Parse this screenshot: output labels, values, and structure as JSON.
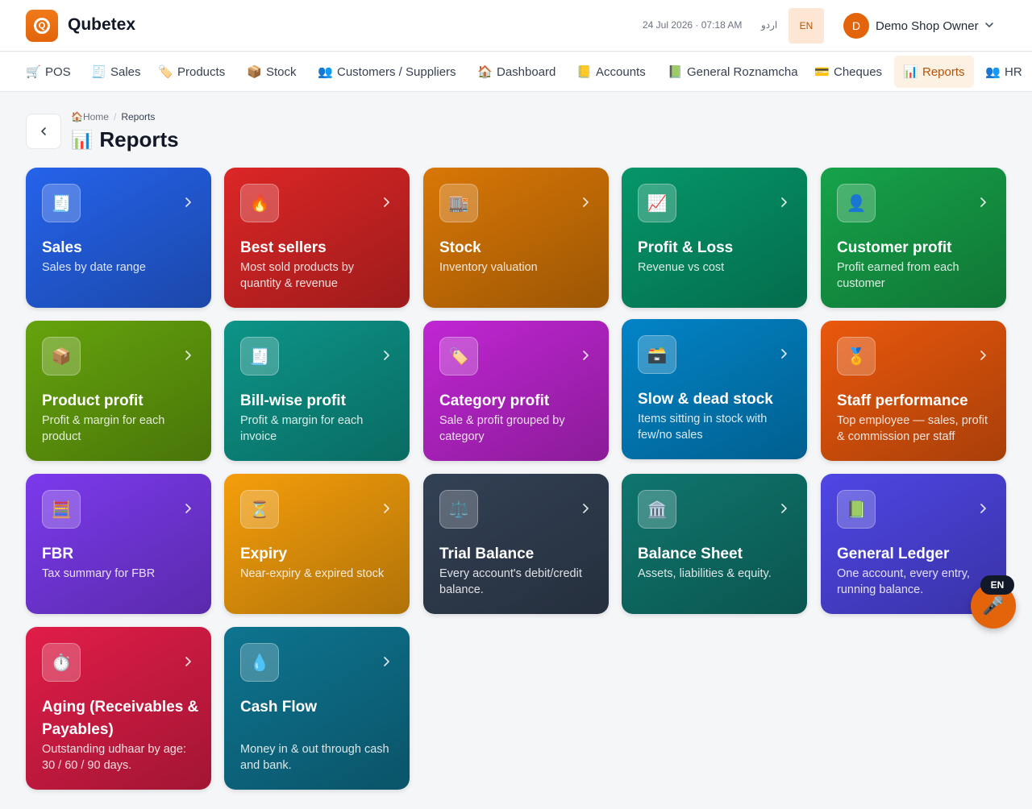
{
  "header": {
    "brand": "Qubetex",
    "logo_letter": "Q",
    "datetime": "24 Jul 2026 · 07:18 AM",
    "urdu_label": "اردو",
    "lang": "EN",
    "user_initial": "D",
    "user_name": "Demo Shop Owner"
  },
  "nav": [
    {
      "icon": "🛒",
      "label": "POS"
    },
    {
      "icon": "🧾",
      "label": "Sales"
    },
    {
      "icon": "🏷️",
      "label": "Products"
    },
    {
      "icon": "📦",
      "label": "Stock"
    },
    {
      "icon": "👥",
      "label": "Customers / Suppliers"
    },
    {
      "icon": "🏠",
      "label": "Dashboard"
    },
    {
      "icon": "📒",
      "label": "Accounts"
    },
    {
      "icon": "📗",
      "label": "General Roznamcha"
    },
    {
      "icon": "💳",
      "label": "Cheques"
    },
    {
      "icon": "📊",
      "label": "Reports"
    },
    {
      "icon": "👥",
      "label": "HR"
    }
  ],
  "breadcrumb": {
    "home_icon": "🏠",
    "home": "Home",
    "current": "Reports"
  },
  "page": {
    "icon": "📊",
    "title": "Reports"
  },
  "cards": [
    {
      "icon": "🧾",
      "title": "Sales",
      "desc": "Sales by date range",
      "color": "#2563eb"
    },
    {
      "icon": "🔥",
      "title": "Best sellers",
      "desc": "Most sold products by quantity & revenue",
      "color": "#dc2626"
    },
    {
      "icon": "🏬",
      "title": "Stock",
      "desc": "Inventory valuation",
      "color": "#d97706"
    },
    {
      "icon": "📈",
      "title": "Profit & Loss",
      "desc": "Revenue vs cost",
      "color": "#059669"
    },
    {
      "icon": "👤",
      "title": "Customer profit",
      "desc": "Profit earned from each customer",
      "color": "#16a34a"
    },
    {
      "icon": "📦",
      "title": "Product profit",
      "desc": "Profit & margin for each product",
      "color": "#65a30d"
    },
    {
      "icon": "🧾",
      "title": "Bill-wise profit",
      "desc": "Profit & margin for each invoice",
      "color": "#0d9488"
    },
    {
      "icon": "🏷️",
      "title": "Category profit",
      "desc": "Sale & profit grouped by category",
      "color": "#c026d3"
    },
    {
      "icon": "🗃️",
      "title": "Slow & dead stock",
      "desc": "Items sitting in stock with few/no sales",
      "color": "#0284c7"
    },
    {
      "icon": "🏅",
      "title": "Staff performance",
      "desc": "Top employee — sales, profit & commission per staff",
      "color": "#ea580c"
    },
    {
      "icon": "🧮",
      "title": "FBR",
      "desc": "Tax summary for FBR",
      "color": "#7c3aed"
    },
    {
      "icon": "⏳",
      "title": "Expiry",
      "desc": "Near-expiry & expired stock",
      "color": "#f59e0b"
    },
    {
      "icon": "⚖️",
      "title": "Trial Balance",
      "desc": "Every account's debit/credit balance.",
      "color": "#334155"
    },
    {
      "icon": "🏛️",
      "title": "Balance Sheet",
      "desc": "Assets, liabilities & equity.",
      "color": "#0f766e"
    },
    {
      "icon": "📗",
      "title": "General Ledger",
      "desc": "One account, every entry, running balance.",
      "color": "#4f46e5"
    },
    {
      "icon": "⏱️",
      "title": "Aging (Receivables & Payables)",
      "desc": "Outstanding udhaar by age: 30 / 60 / 90 days.",
      "color": "#e11d48"
    },
    {
      "icon": "💧",
      "title": "Cash Flow",
      "desc": "Money in & out through cash and bank.",
      "color": "#0e7490"
    }
  ],
  "voice": {
    "badge": "EN",
    "icon": "🎤"
  }
}
